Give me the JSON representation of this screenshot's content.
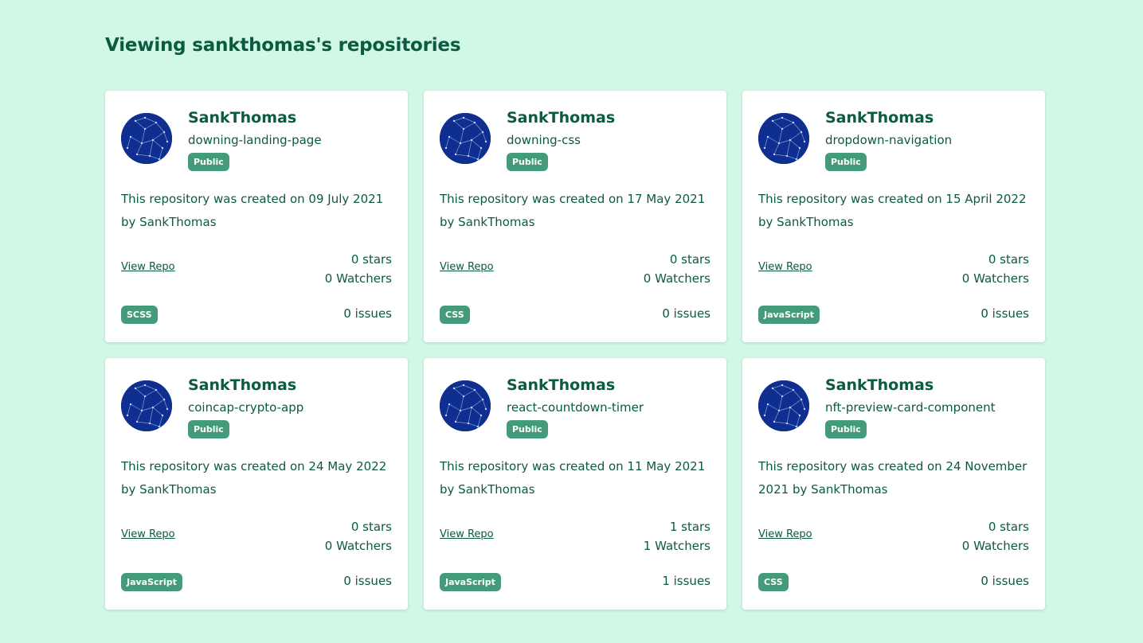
{
  "header": {
    "title": "Viewing sankthomas's repositories"
  },
  "labels": {
    "view_repo": "View Repo",
    "stars_suffix": " stars",
    "watchers_suffix": " Watchers",
    "issues_suffix": " issues"
  },
  "colors": {
    "background": "#d0f8e4",
    "accent": "#0b5a41",
    "badge": "#449b7a",
    "avatar": "#0e2f8f"
  },
  "repos": [
    {
      "owner": "SankThomas",
      "name": "downing-landing-page",
      "visibility": "Public",
      "description": "This repository was created on 09 July 2021 by SankThomas",
      "stars": "0 stars",
      "watchers": "0 Watchers",
      "language": "SCSS",
      "issues": "0 issues"
    },
    {
      "owner": "SankThomas",
      "name": "downing-css",
      "visibility": "Public",
      "description": "This repository was created on 17 May 2021 by SankThomas",
      "stars": "0 stars",
      "watchers": "0 Watchers",
      "language": "CSS",
      "issues": "0 issues"
    },
    {
      "owner": "SankThomas",
      "name": "dropdown-navigation",
      "visibility": "Public",
      "description": "This repository was created on 15 April 2022 by SankThomas",
      "stars": "0 stars",
      "watchers": "0 Watchers",
      "language": "JavaScript",
      "issues": "0 issues"
    },
    {
      "owner": "SankThomas",
      "name": "coincap-crypto-app",
      "visibility": "Public",
      "description": "This repository was created on 24 May 2022 by SankThomas",
      "stars": "0 stars",
      "watchers": "0 Watchers",
      "language": "JavaScript",
      "issues": "0 issues"
    },
    {
      "owner": "SankThomas",
      "name": "react-countdown-timer",
      "visibility": "Public",
      "description": "This repository was created on 11 May 2021 by SankThomas",
      "stars": "1 stars",
      "watchers": "1 Watchers",
      "language": "JavaScript",
      "issues": "1 issues"
    },
    {
      "owner": "SankThomas",
      "name": "nft-preview-card-component",
      "visibility": "Public",
      "description": "This repository was created on 24 November 2021 by SankThomas",
      "stars": "0 stars",
      "watchers": "0 Watchers",
      "language": "CSS",
      "issues": "0 issues"
    }
  ]
}
